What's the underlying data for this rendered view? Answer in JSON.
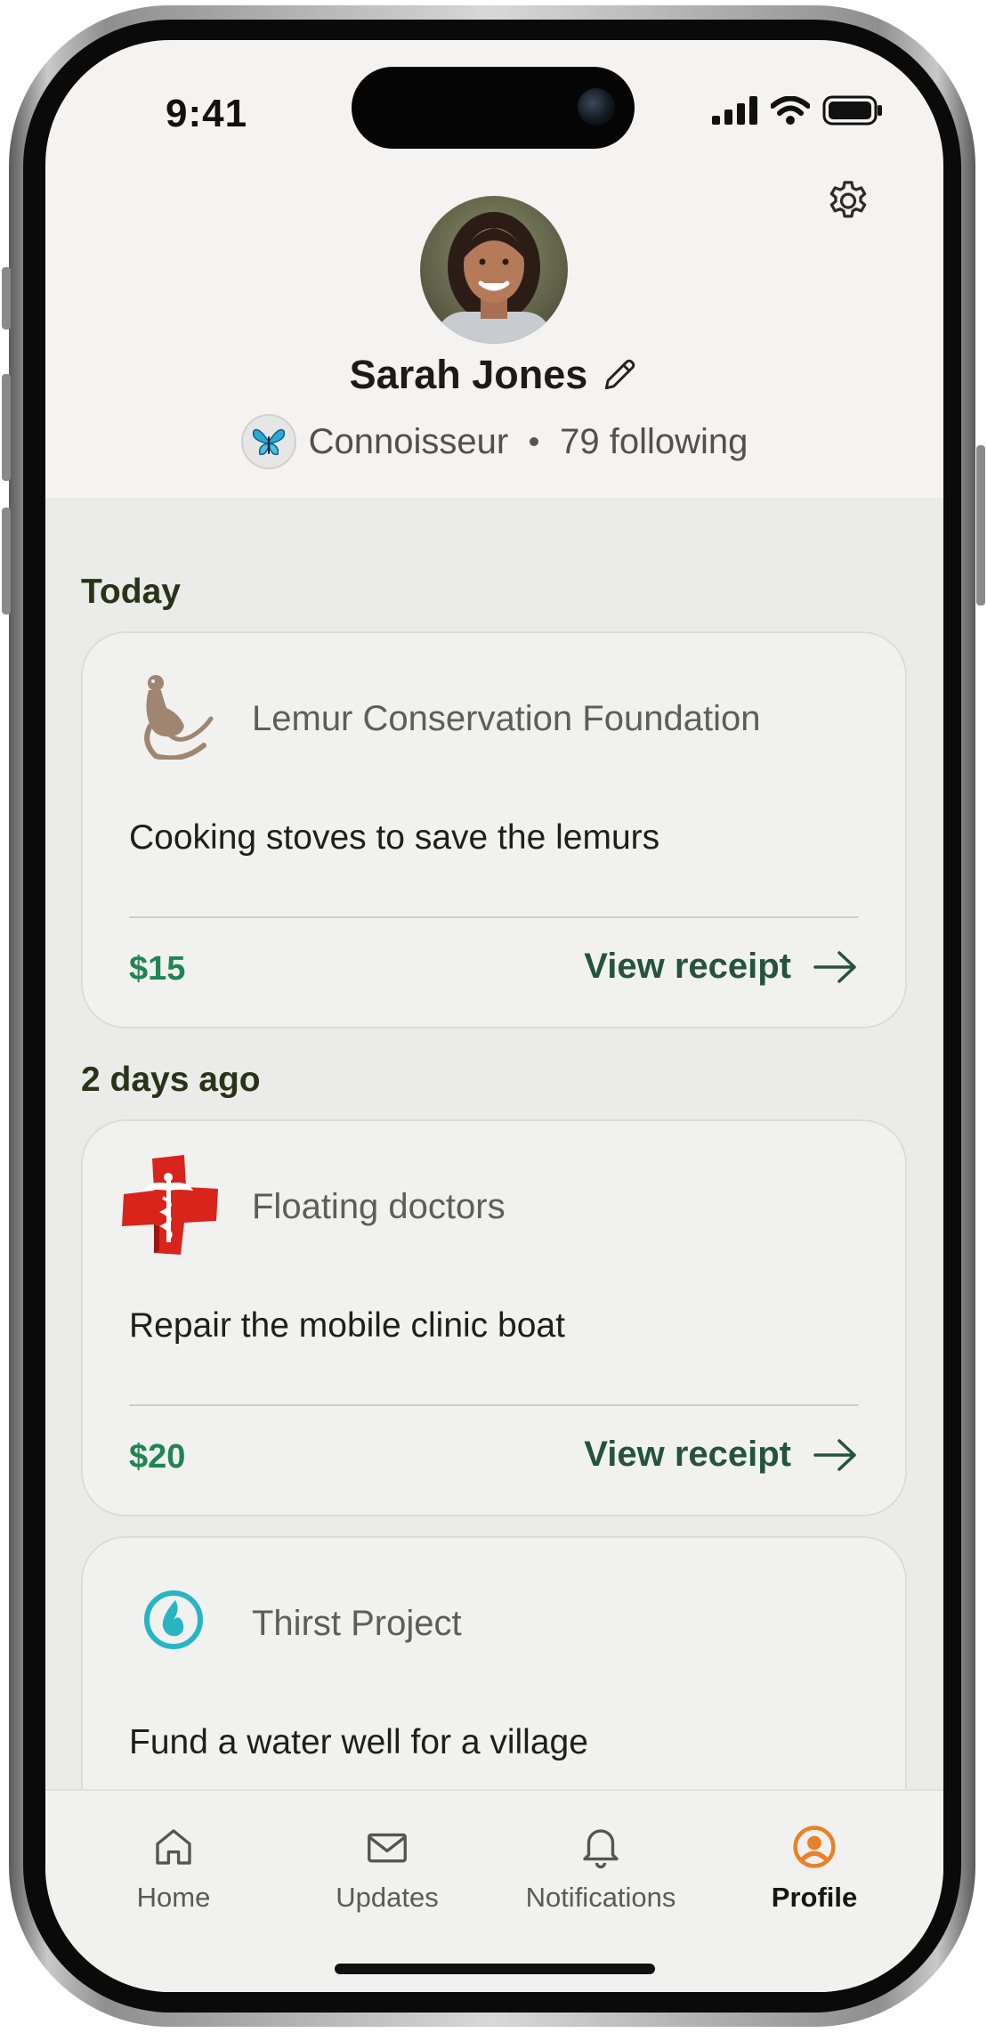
{
  "status_bar": {
    "time": "9:41"
  },
  "profile": {
    "name": "Sarah Jones",
    "badge": "Connoisseur",
    "following": "79 following"
  },
  "feed": [
    {
      "date_label": "Today",
      "org": "Lemur Conservation Foundation",
      "description": "Cooking stoves to save the lemurs",
      "amount": "$15",
      "receipt_label": "View receipt",
      "logo_icon": "lemur-logo"
    },
    {
      "date_label": "2 days ago",
      "org": "Floating doctors",
      "description": "Repair the mobile clinic boat",
      "amount": "$20",
      "receipt_label": "View receipt",
      "logo_icon": "red-cross-caduceus-logo"
    },
    {
      "org": "Thirst Project",
      "description": "Fund a water well for a village",
      "logo_icon": "water-drop-logo"
    }
  ],
  "tabs": [
    {
      "label": "Home",
      "icon": "home-icon"
    },
    {
      "label": "Updates",
      "icon": "mail-icon"
    },
    {
      "label": "Notifications",
      "icon": "bell-icon"
    },
    {
      "label": "Profile",
      "icon": "profile-icon",
      "active": true
    }
  ],
  "colors": {
    "accent_green": "#1f8551",
    "receipt_green": "#24533f",
    "profile_orange": "#e8822a",
    "thirst_teal": "#27b5c4",
    "cross_red": "#d9241c"
  }
}
